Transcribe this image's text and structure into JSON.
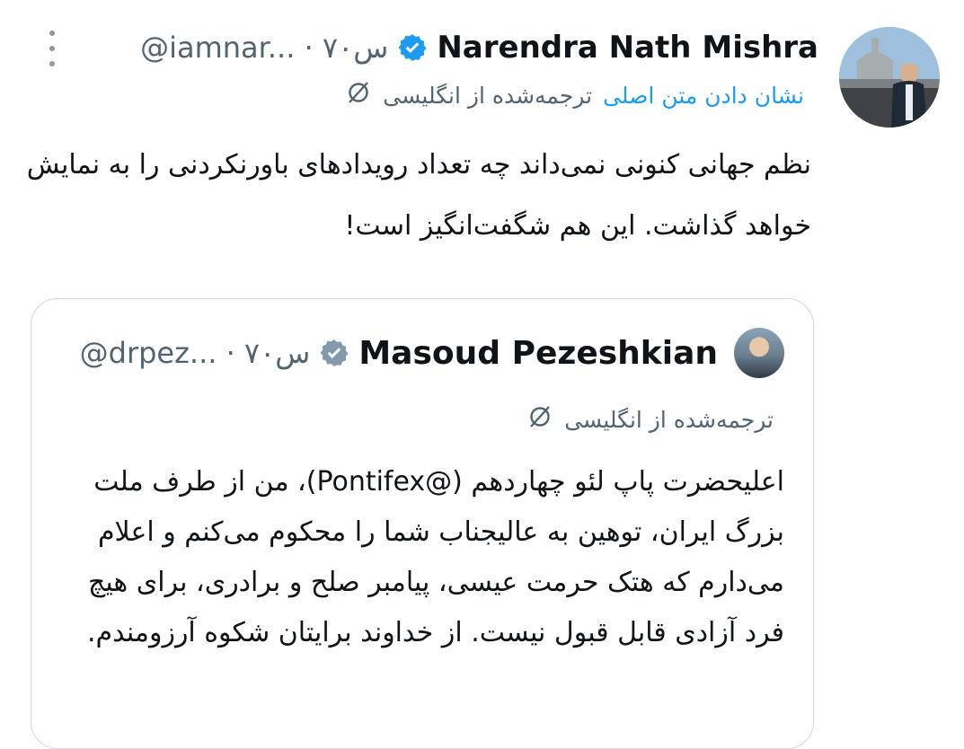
{
  "tweet": {
    "author_name": "Narendra Nath Mishra",
    "handle_time": "@iamnar... · ۷۰س",
    "translated_label": "ترجمه‌شده از انگلیسی",
    "show_original_link": "نشان دادن متن اصلی",
    "text": "نظم جهانی کنونی نمی‌داند چه تعداد رویدادهای باورنکردنی را به نمایش خواهد گذاشت. این هم شگفت‌انگیز است!"
  },
  "quote": {
    "author_name": "Masoud Pezeshkian",
    "handle_time": "@drpez... · ۷۰س",
    "translated_label": "ترجمه‌شده از انگلیسی",
    "text": "اعلیحضرت پاپ لئو چهاردهم (@Pontifex)، من از طرف ملت بزرگ ایران، توهین به عالیجناب شما را محکوم می‌کنم و اعلام می‌دارم که هتک حرمت عیسی، پیامبر صلح و برادری، برای هیچ فرد آزادی قابل قبول نیست. از خداوند برایتان شکوه آرزومندم."
  },
  "icons": {
    "verified": "verified-badge-icon",
    "translate": "translate-icon",
    "more": "more-icon"
  },
  "colors": {
    "verified_main": "#1d9bf0",
    "verified_quote": "#829aab",
    "link": "#1d9bf0",
    "muted": "#536471",
    "border": "#cfd9de"
  }
}
